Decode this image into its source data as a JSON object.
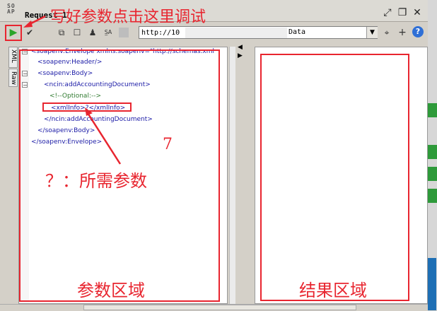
{
  "window": {
    "logo_text": "SO AP",
    "title": "Request 1",
    "buttons": [
      "maximize-restore",
      "restore",
      "close"
    ]
  },
  "toolbar": {
    "icons": [
      "run-icon",
      "validate-icon",
      "fullscreen-icon",
      "stop-icon",
      "attachment-icon",
      "wsa-icon",
      "settings-icon"
    ],
    "url_prefix": "http://10",
    "url_suffix": "Data",
    "right_icons": [
      "pin-icon",
      "add-icon",
      "help-icon"
    ],
    "help_glyph": "?"
  },
  "tabs": {
    "xml": "XML",
    "raw": "Raw"
  },
  "request_xml": [
    "<soapenv:Envelope xmlns:soapenv=\"http://schemas.xml",
    "<soapenv:Header/>",
    "<soapenv:Body>",
    "<ncin:addAccountingDocument>",
    "<!--Optional:-->",
    "<xmlInfo>?</xmlInfo>",
    "</ncin:addAccountingDocument>",
    "</soapenv:Body>",
    "</soapenv:Envelope>"
  ],
  "annotations": {
    "top_note": "写好参数点击这里调试",
    "param_note": "？：所需参数",
    "number_note": "7",
    "param_area": "参数区域",
    "result_area": "结果区域"
  },
  "colors": {
    "annotation_red": "#e8252f",
    "xml_tag": "#1a1aa6",
    "xml_comment": "#2f7a2f",
    "run_green": "#2aa52a"
  }
}
